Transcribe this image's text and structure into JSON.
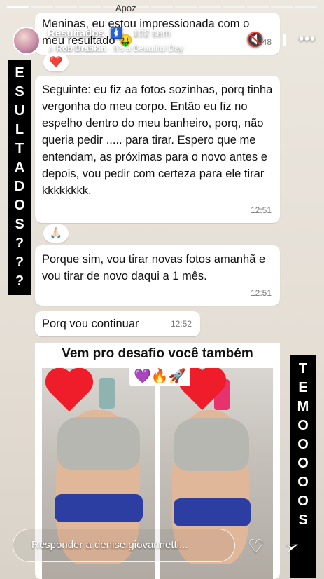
{
  "story": {
    "progress_segments": [
      1,
      0,
      0,
      0,
      0,
      0,
      0,
      0,
      0,
      0,
      0,
      0,
      0
    ],
    "header": {
      "username": "Resultados",
      "user_icon": "restroom-person-icon",
      "age": "102 sem",
      "music_artist": "Rob Drabkin",
      "music_sep": "·",
      "music_title": "It's a Beautiful Day",
      "mute_icon": "muted-speaker-icon",
      "pause_icon": "pause-icon",
      "more_icon": "ellipsis-icon"
    },
    "side_text_left": [
      "E",
      "S",
      "U",
      "L",
      "T",
      "A",
      "D",
      "O",
      "S",
      "?",
      "?",
      "?"
    ],
    "side_text_right": [
      "T",
      "E",
      "M",
      "O",
      "O",
      "O",
      "O",
      "O",
      "S"
    ],
    "footer": {
      "reply_placeholder": "Responder a denise.giovannetti...",
      "like_icon": "heart-outline-icon",
      "share_icon": "send-paper-plane-icon"
    }
  },
  "chat": {
    "messages": [
      {
        "text": "Meninas, eu estou impressionada com o meu resultado 🤑",
        "time": "12:48",
        "reaction": "❤️"
      },
      {
        "text": "Seguinte: eu fiz aa fotos sozinhas, porq tinha vergonha do meu corpo. Então eu fiz no espelho dentro do meu banheiro, porq, não queria pedir ..... para tirar. Espero que me entendam, as próximas para o novo antes e depois, vou pedir com certeza para ele tirar kkkkkkkk.",
        "time": "12:51",
        "reaction": "🙏🏻"
      },
      {
        "text": "Porque sim, vou tirar novas fotos amanhã e vou tirar de novo daqui a 1 mês.",
        "time": "12:51"
      },
      {
        "text": "Porq vou continuar",
        "time": "12:52"
      }
    ],
    "photo_title": "Vem pro desafio você também",
    "photo_emojis": "💜🔥🚀",
    "top_partial": "Apoz"
  }
}
